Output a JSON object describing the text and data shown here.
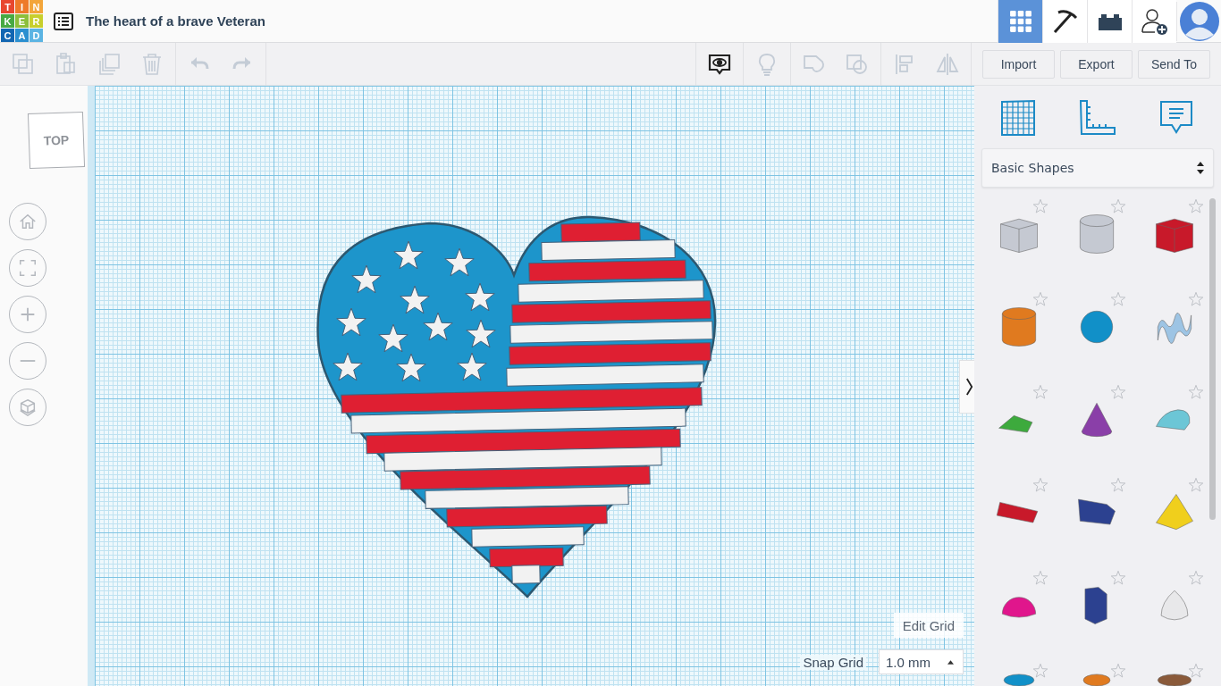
{
  "logo": {
    "letters": [
      {
        "char": "T",
        "color": "#e8472f"
      },
      {
        "char": "I",
        "color": "#ee7a2a"
      },
      {
        "char": "N",
        "color": "#f3a53a"
      },
      {
        "char": "K",
        "color": "#48a943"
      },
      {
        "char": "E",
        "color": "#8dbf3c"
      },
      {
        "char": "R",
        "color": "#c8cf2d"
      },
      {
        "char": "C",
        "color": "#1266b2"
      },
      {
        "char": "A",
        "color": "#2b8fd0"
      },
      {
        "char": "D",
        "color": "#5bb4e3"
      }
    ]
  },
  "header": {
    "title": "The heart of a brave Veteran",
    "tabs": [
      {
        "kind": "grid",
        "selected": true
      },
      {
        "kind": "pickaxe",
        "selected": false
      },
      {
        "kind": "bricks",
        "selected": false
      },
      {
        "kind": "invite",
        "selected": false
      }
    ]
  },
  "toolbar": {
    "left_groups": [
      [
        {
          "kind": "copy",
          "disabled": true
        },
        {
          "kind": "paste",
          "disabled": true
        },
        {
          "kind": "duplicate",
          "disabled": true
        },
        {
          "kind": "delete",
          "disabled": true
        }
      ],
      [
        {
          "kind": "undo",
          "disabled": true
        },
        {
          "kind": "redo",
          "disabled": true
        }
      ]
    ],
    "right_groups": [
      [
        {
          "kind": "notes",
          "disabled": false
        }
      ],
      [
        {
          "kind": "bulb",
          "disabled": true
        }
      ],
      [
        {
          "kind": "solid",
          "disabled": true
        },
        {
          "kind": "hole",
          "disabled": true
        }
      ],
      [
        {
          "kind": "align",
          "disabled": true
        },
        {
          "kind": "mirror",
          "disabled": true
        }
      ]
    ],
    "buttons": [
      "Import",
      "Export",
      "Send To"
    ]
  },
  "view_cube": {
    "label": "TOP"
  },
  "nav_buttons": [
    {
      "kind": "home"
    },
    {
      "kind": "fit"
    },
    {
      "kind": "zoom-in"
    },
    {
      "kind": "zoom-out"
    },
    {
      "kind": "ortho"
    }
  ],
  "canvas": {
    "edit_grid": "Edit Grid",
    "snap_grid": {
      "label": "Snap Grid",
      "value": "1.0 mm"
    }
  },
  "panel": {
    "views": [
      {
        "kind": "workplane"
      },
      {
        "kind": "ruler"
      },
      {
        "kind": "notes"
      }
    ],
    "library": "Basic Shapes",
    "shapes": [
      {
        "kind": "box",
        "color": "#c5c9d2"
      },
      {
        "kind": "cylinder",
        "color": "#c5c9d2"
      },
      {
        "kind": "box",
        "color": "#c8192a"
      },
      {
        "kind": "cylinder",
        "color": "#e07a1f"
      },
      {
        "kind": "sphere",
        "color": "#1190c8"
      },
      {
        "kind": "scribble",
        "color": "#9dc4e4"
      },
      {
        "kind": "roof",
        "color": "#3daa3d"
      },
      {
        "kind": "cone",
        "color": "#8a3fa8"
      },
      {
        "kind": "round-roof",
        "color": "#6cc6d6"
      },
      {
        "kind": "text",
        "color": "#c8192a"
      },
      {
        "kind": "wedge",
        "color": "#2c4190"
      },
      {
        "kind": "pyramid",
        "color": "#f0cf1c"
      },
      {
        "kind": "half-sphere",
        "color": "#e0168c"
      },
      {
        "kind": "polygon",
        "color": "#2c4190"
      },
      {
        "kind": "paraboloid",
        "color": "#e8e8ea"
      },
      {
        "kind": "torus",
        "color": "#1190c8"
      },
      {
        "kind": "tube",
        "color": "#e07a1f"
      },
      {
        "kind": "blob",
        "color": "#8a5a3a"
      }
    ]
  }
}
